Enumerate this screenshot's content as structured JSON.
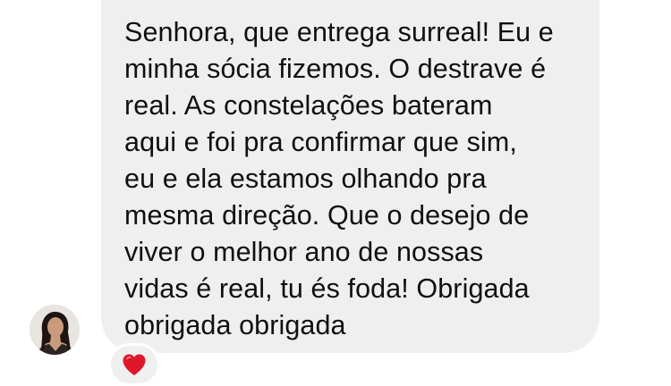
{
  "message": {
    "text": "Senhora, que entrega surreal! Eu e\nminha sócia fizemos. O destrave é\nreal. As constelações bateram\naqui e foi pra confirmar que sim,\neu e ela estamos olhando pra\nmesma direção. Que o desejo de\nviver o melhor ano de nossas\nvidas é real, tu és foda! Obrigada\nobrigada obrigada"
  },
  "reaction": {
    "icon": "heart-icon",
    "color": "#e0162b"
  },
  "colors": {
    "bubble_background": "#efefef",
    "text": "#101010",
    "page_background": "#ffffff"
  }
}
